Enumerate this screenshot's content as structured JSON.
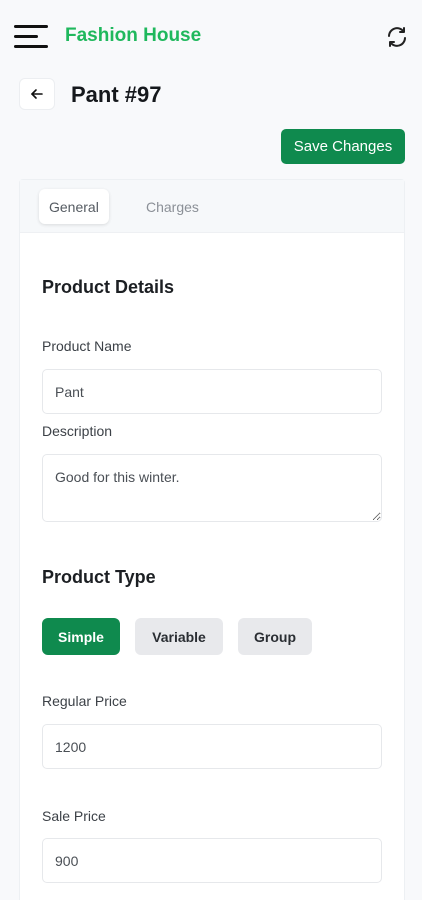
{
  "header": {
    "brand": "Fashion House"
  },
  "page": {
    "title": "Pant #97",
    "save_label": "Save Changes"
  },
  "tabs": [
    {
      "label": "General",
      "active": true
    },
    {
      "label": "Charges",
      "active": false
    }
  ],
  "product_details": {
    "title": "Product Details",
    "name_label": "Product Name",
    "name_value": "Pant",
    "description_label": "Description",
    "description_value": "Good for this winter."
  },
  "product_type": {
    "title": "Product Type",
    "options": [
      "Simple",
      "Variable",
      "Group"
    ],
    "selected": "Simple"
  },
  "pricing": {
    "regular_label": "Regular Price",
    "regular_value": "1200",
    "sale_label": "Sale Price",
    "sale_value": "900"
  },
  "colors": {
    "brand": "#1fb85d",
    "accent": "#0f8a4e"
  },
  "icons": {
    "menu": "hamburger-icon",
    "refresh": "refresh-icon",
    "back": "arrow-left-icon"
  }
}
